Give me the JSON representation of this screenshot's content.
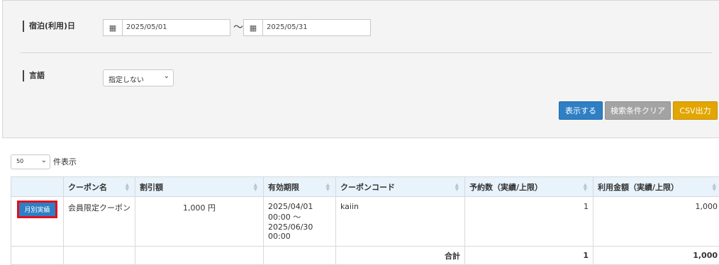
{
  "filters": {
    "stay_date_label": "宿泊(利用)日",
    "date_from": "2025/05/01",
    "date_to": "2025/05/31",
    "range_sep": "～",
    "language_label": "言語",
    "language_value": "指定しない"
  },
  "buttons": {
    "show": "表示する",
    "clear": "検索条件クリア",
    "csv": "CSV出力"
  },
  "paging": {
    "per_page_value": "50",
    "per_page_suffix": "件表示"
  },
  "table": {
    "headers": [
      "",
      "クーポン名",
      "割引額",
      "有効期限",
      "クーポンコード",
      "予約数（実績/上限）",
      "利用金額（実績/上限）"
    ],
    "row": {
      "action": "月別実績",
      "name": "会員限定クーポン",
      "discount": "1,000 円",
      "validity": "2025/04/01 00:00 ～ 2025/06/30 00:00",
      "code": "kaiin",
      "reservations": "1",
      "amount": "1,000"
    },
    "total": {
      "label": "合計",
      "reservations": "1",
      "amount": "1,000"
    }
  }
}
